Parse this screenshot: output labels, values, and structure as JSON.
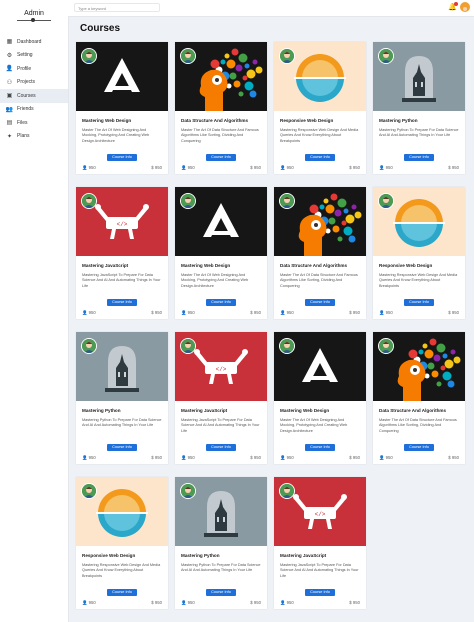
{
  "sidebar": {
    "brand": "Admin",
    "items": [
      {
        "label": "Dashboard",
        "icon": "dashboard-icon",
        "glyph": "▦",
        "active": false
      },
      {
        "label": "Setting",
        "icon": "gear-icon",
        "glyph": "⚙",
        "active": false
      },
      {
        "label": "Profile",
        "icon": "user-icon",
        "glyph": "👤",
        "active": false
      },
      {
        "label": "Projects",
        "icon": "sitemap-icon",
        "glyph": "⚇",
        "active": false
      },
      {
        "label": "Courses",
        "icon": "book-icon",
        "glyph": "▣",
        "active": true
      },
      {
        "label": "Friends",
        "icon": "users-icon",
        "glyph": "👥",
        "active": false
      },
      {
        "label": "Files",
        "icon": "file-icon",
        "glyph": "▤",
        "active": false
      },
      {
        "label": "Plans",
        "icon": "plans-icon",
        "glyph": "✦",
        "active": false
      }
    ]
  },
  "topbar": {
    "search_placeholder": "Type a keyword"
  },
  "page": {
    "title": "Courses"
  },
  "button_label": "Course Info",
  "courses": [
    {
      "title": "Mastering Web Design",
      "desc": "Master The Art Of Web Designing And Mocking, Prototyping And Creating Web Design Architecture",
      "count": "950",
      "price": "$ 950",
      "theme": "web"
    },
    {
      "title": "Data Structure And Algorithms",
      "desc": "Master The Art Of Data Structure And Famous Algorithms Like Sorting, Dividing And Conquering",
      "count": "950",
      "price": "$ 950",
      "theme": "data"
    },
    {
      "title": "Responsive Web Design",
      "desc": "Mastering Responsive Web Design And Media Queries And Know Everything About Breakpoints",
      "count": "950",
      "price": "$ 950",
      "theme": "responsive"
    },
    {
      "title": "Mastering Python",
      "desc": "Mastering Python To Prepare For Data Science And AI And Automating Things In Your Life",
      "count": "950",
      "price": "$ 950",
      "theme": "python"
    },
    {
      "title": "Mastering JavaScript",
      "desc": "Mastering JavaScript To Prepare For Data Science And AI And Automating Things In Your Life",
      "count": "950",
      "price": "$ 950",
      "theme": "js"
    },
    {
      "title": "Mastering Web Design",
      "desc": "Master The Art Of Web Designing And Mocking, Prototyping And Creating Web Design Architecture",
      "count": "950",
      "price": "$ 950",
      "theme": "web"
    },
    {
      "title": "Data Structure And Algorithms",
      "desc": "Master The Art Of Data Structure And Famous Algorithms Like Sorting, Dividing And Conquering",
      "count": "950",
      "price": "$ 950",
      "theme": "data"
    },
    {
      "title": "Responsive Web Design",
      "desc": "Mastering Responsive Web Design And Media Queries And Know Everything About Breakpoints",
      "count": "950",
      "price": "$ 950",
      "theme": "responsive"
    },
    {
      "title": "Mastering Python",
      "desc": "Mastering Python To Prepare For Data Science And AI And Automating Things In Your Life",
      "count": "950",
      "price": "$ 950",
      "theme": "python"
    },
    {
      "title": "Mastering JavaScript",
      "desc": "Mastering JavaScript To Prepare For Data Science And AI And Automating Things In Your Life",
      "count": "950",
      "price": "$ 950",
      "theme": "js"
    },
    {
      "title": "Mastering Web Design",
      "desc": "Master The Art Of Web Designing And Mocking, Prototyping And Creating Web Design Architecture",
      "count": "950",
      "price": "$ 950",
      "theme": "web"
    },
    {
      "title": "Data Structure And Algorithms",
      "desc": "Master The Art Of Data Structure And Famous Algorithms Like Sorting, Dividing And Conquering",
      "count": "950",
      "price": "$ 950",
      "theme": "data"
    },
    {
      "title": "Responsive Web Design",
      "desc": "Mastering Responsive Web Design And Media Queries And Know Everything About Breakpoints",
      "count": "950",
      "price": "$ 950",
      "theme": "responsive"
    },
    {
      "title": "Mastering Python",
      "desc": "Mastering Python To Prepare For Data Science And AI And Automating Things In Your Life",
      "count": "950",
      "price": "$ 950",
      "theme": "python"
    },
    {
      "title": "Mastering JavaScript",
      "desc": "Mastering JavaScript To Prepare For Data Science And AI And Automating Things In Your Life",
      "count": "950",
      "price": "$ 950",
      "theme": "js"
    }
  ],
  "colors": {
    "accent": "#1e6fd9",
    "web_bg": "#161616",
    "data_bg": "#161616",
    "responsive_bg": "#fde5cc",
    "python_bg": "#8a9aa3",
    "js_bg": "#c8303a"
  }
}
